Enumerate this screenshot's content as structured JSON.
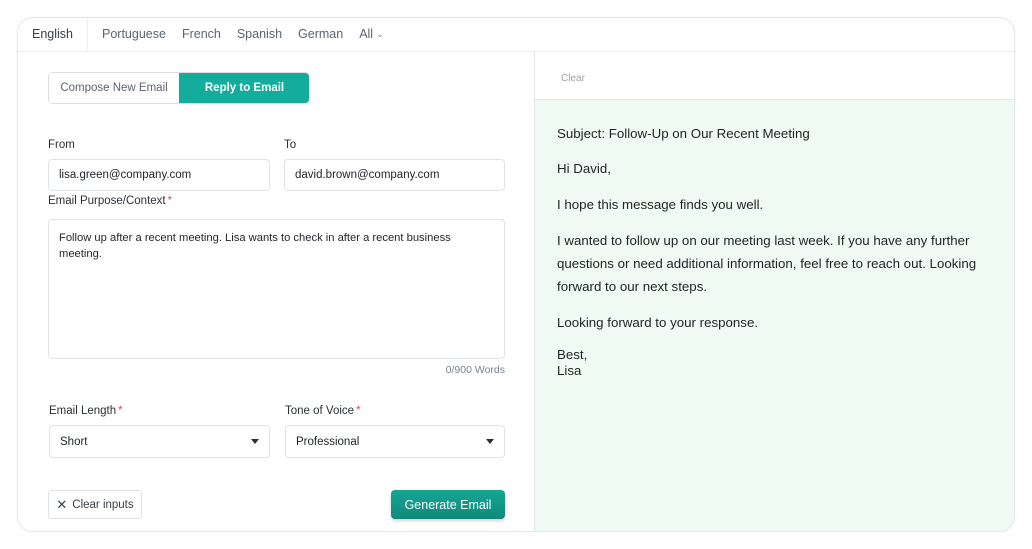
{
  "languages": {
    "tabs": [
      "English",
      "Portuguese",
      "French",
      "Spanish",
      "German"
    ],
    "all_label": "All",
    "active": "English"
  },
  "mode": {
    "compose_label": "Compose New Email",
    "reply_label": "Reply to Email",
    "active": "reply"
  },
  "form": {
    "from_label": "From",
    "from_value": "lisa.green@company.com",
    "to_label": "To",
    "to_value": "david.brown@company.com",
    "purpose_label": "Email Purpose/Context",
    "purpose_value": "Follow up after a recent meeting. Lisa wants to check in after a recent business meeting.",
    "word_count": "0/900 Words",
    "length_label": "Email Length",
    "length_value": "Short",
    "tone_label": "Tone of Voice",
    "tone_value": "Professional",
    "required_mark": "*",
    "clear_inputs_label": "Clear inputs",
    "generate_label": "Generate Email"
  },
  "output": {
    "clear_label": "Clear",
    "subject": "Subject: Follow-Up on Our Recent Meeting",
    "greeting": "Hi David,",
    "paragraph1": "I hope this message finds you well.",
    "paragraph2": "I wanted to follow up on our meeting last week. If you have any further questions or need additional information, feel free to reach out. Looking forward to our next steps.",
    "paragraph3": "Looking forward to your response.",
    "signoff": "Best,",
    "signature": "Lisa"
  },
  "colors": {
    "accent": "#14ac9c",
    "output_bg": "#eefaf3",
    "required": "#e24a3b"
  }
}
